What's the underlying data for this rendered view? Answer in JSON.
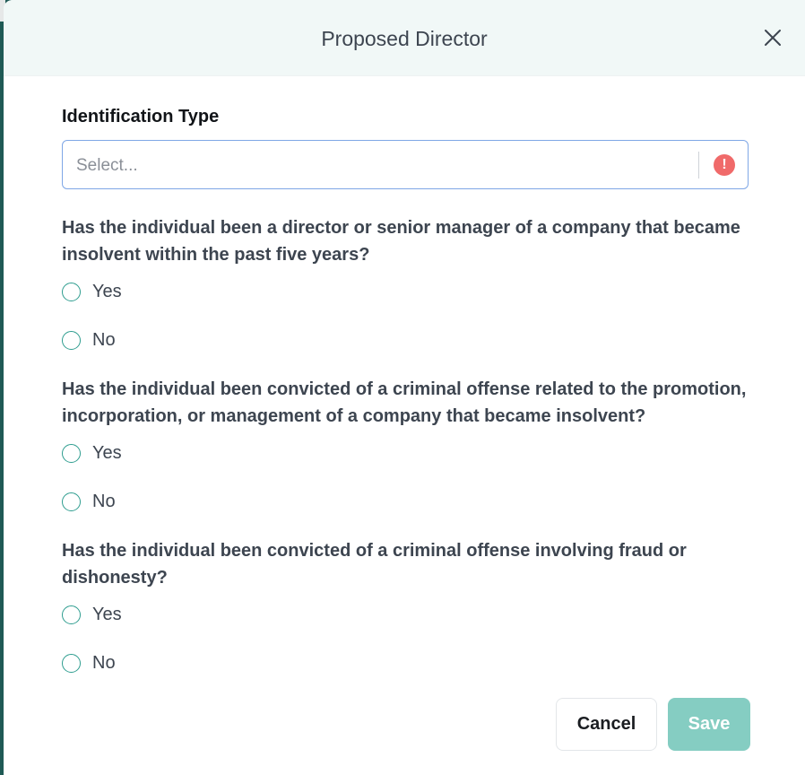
{
  "dialog": {
    "title": "Proposed Director",
    "close_icon": "close-icon"
  },
  "identification": {
    "label": "Identification Type",
    "placeholder": "Select...",
    "status_icon": "error-exclamation-icon",
    "error_color": "#f06a6a"
  },
  "questions": [
    {
      "text": "Has the individual been a director or senior manager of a company that became insolvent within the past five years?",
      "options": [
        "Yes",
        "No"
      ]
    },
    {
      "text": "Has the individual been convicted of a criminal offense related to the promotion, incorporation, or management of a company that became insolvent?",
      "options": [
        "Yes",
        "No"
      ]
    },
    {
      "text": "Has the individual been convicted of a criminal offense involving fraud or dishonesty?",
      "options": [
        "Yes",
        "No"
      ]
    }
  ],
  "footer": {
    "cancel_label": "Cancel",
    "save_label": "Save"
  },
  "colors": {
    "accent": "#2e9d8f",
    "save_disabled": "#85cdc2",
    "header_bg": "#f1f8f7"
  }
}
